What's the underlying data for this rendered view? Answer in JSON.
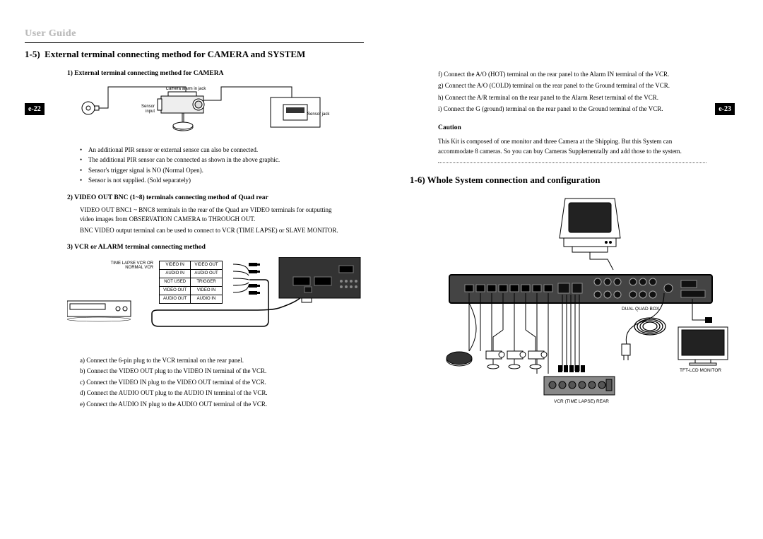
{
  "header": {
    "title": "User Guide"
  },
  "pages": {
    "left_num": "e-22",
    "right_num": "e-23"
  },
  "sec15": {
    "title": "1-5)  External terminal connecting method for CAMERA and SYSTEM",
    "h1": "1) External terminal connecting method for CAMERA",
    "d1_labels": {
      "cam_jack": "Camera alarm in jack",
      "sensor_input": "Sensor input",
      "sensor_jack": "Sensor jack"
    },
    "bullets1": [
      "An additional PIR sensor or external sensor can also be connected.",
      "The additional PIR sensor can be connected as shown in the above graphic.",
      "Sensor's trigger signal is NO (Normal Open).",
      "Sensor is not supplied. (Sold separately)"
    ],
    "h2": "2) VIDEO OUT BNC (1~8) terminals connecting method of Quad rear",
    "p2a": "VIDEO OUT BNC1 ~ BNC8 terminals in the rear of the Quad are VIDEO terminals for outputting",
    "p2b": "video images from OBSERVATION CAMERA to THROUGH OUT.",
    "p2c": "BNC VIDEO output terminal can be used to connect to VCR (TIME LAPSE) or SLAVE MONITOR.",
    "h3": "3) VCR or ALARM terminal connecting method",
    "vcr_label": "TIME LAPSE VCR OR NORMAL VCR",
    "vcr_table": [
      [
        "VIDEO IN",
        "VIDEO OUT"
      ],
      [
        "AUDIO IN",
        "AUDIO OUT"
      ],
      [
        "NOT USED",
        "TRIGGER"
      ],
      [
        "VIDEO OUT",
        "VIDEO IN"
      ],
      [
        "AUDIO OUT",
        "AUDIO IN"
      ]
    ],
    "steps": [
      "a) Connect the 6-pin plug to the VCR terminal on the rear panel.",
      "b) Connect the VIDEO OUT plug to the VIDEO IN terminal of the VCR.",
      "c) Connect the VIDEO IN plug to the VIDEO OUT terminal of the VCR.",
      "d) Connect the AUDIO OUT plug to the AUDIO IN terminal of the VCR.",
      "e) Connect the AUDIO IN plug to the AUDIO OUT terminal of the VCR."
    ]
  },
  "sec_right": {
    "steps_cont": [
      "f) Connect the A/O (HOT) terminal on the rear panel to the Alarm IN terminal of the VCR.",
      "g) Connect the A/O (COLD) terminal on the rear panel to the Ground terminal of the VCR.",
      "h) Connect the A/R terminal on the rear panel to the Alarm Reset terminal of the VCR.",
      "i) Connect the G (ground) terminal on the rear panel to the Ground terminal of the VCR."
    ],
    "caution_h": "Caution",
    "caution_body": "This Kit is composed of one monitor and three Camera at the Shipping. But this System can accommodate 8 cameras. So you can buy Cameras Supplementally and add those to the system.",
    "sec16_title": "1-6) Whole System connection and configuration",
    "bd_labels": {
      "dual_quad": "DUAL QUAD BOX",
      "tft": "TFT-LCD MONITOR",
      "vcr_rear": "VCR (TIME LAPSE) REAR"
    }
  }
}
